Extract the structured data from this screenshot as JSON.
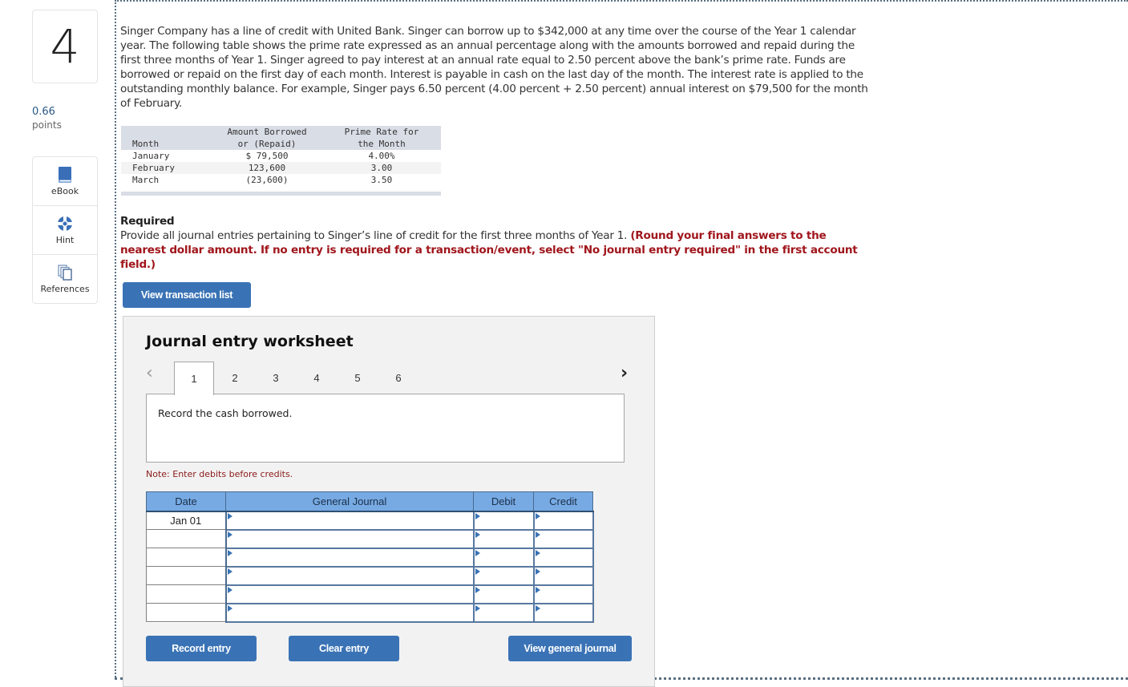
{
  "question": {
    "number": "4",
    "points_value": "0.66",
    "points_label": "points"
  },
  "tools": [
    {
      "label": "eBook",
      "icon": "book-icon"
    },
    {
      "label": "Hint",
      "icon": "lifebuoy-icon"
    },
    {
      "label": "References",
      "icon": "copy-pages-icon"
    }
  ],
  "intro_text": "Singer Company has a line of credit with United Bank. Singer can borrow up to $342,000 at any time over the course of the Year 1 calendar year. The following table shows the prime rate expressed as an annual percentage along with the amounts borrowed and repaid during the first three months of Year 1. Singer agreed to pay interest at an annual rate equal to 2.50 percent above the bank’s prime rate. Funds are borrowed or repaid on the first day of each month. Interest is payable in cash on the last day of the month. The interest rate is applied to the outstanding monthly balance. For example, Singer pays 6.50 percent (4.00 percent + 2.50 percent) annual interest on $79,500 for the month of February.",
  "rate_table": {
    "headers": {
      "month": "Month",
      "amount_line1": "Amount Borrowed",
      "amount_line2": "or (Repaid)",
      "rate_line1": "Prime Rate for",
      "rate_line2": "the Month"
    },
    "rows": [
      {
        "month": "January",
        "amount": "$ 79,500",
        "rate": "4.00%"
      },
      {
        "month": "February",
        "amount": "123,600",
        "rate": "3.00"
      },
      {
        "month": "March",
        "amount": "(23,600)",
        "rate": "3.50"
      }
    ]
  },
  "required": {
    "title": "Required",
    "text": "Provide all journal entries pertaining to Singer’s line of credit for the first three months of Year 1. ",
    "warning": "(Round your final answers to the nearest dollar amount. If no entry is required for a transaction/event, select \"No journal entry required\" in the first account field.)"
  },
  "buttons": {
    "view_transactions": "View transaction list",
    "record_entry": "Record entry",
    "clear_entry": "Clear entry",
    "view_general_journal": "View general journal"
  },
  "worksheet": {
    "title": "Journal entry worksheet",
    "tabs": [
      "1",
      "2",
      "3",
      "4",
      "5",
      "6"
    ],
    "active_tab": "1",
    "prev_glyph": "‹",
    "next_glyph": "›",
    "prompt": "Record the cash borrowed.",
    "note": "Note: Enter debits before credits.",
    "columns": {
      "date": "Date",
      "general_journal": "General Journal",
      "debit": "Debit",
      "credit": "Credit"
    },
    "rows": [
      {
        "date": "Jan 01",
        "account": "",
        "debit": "",
        "credit": ""
      },
      {
        "date": "",
        "account": "",
        "debit": "",
        "credit": ""
      },
      {
        "date": "",
        "account": "",
        "debit": "",
        "credit": ""
      },
      {
        "date": "",
        "account": "",
        "debit": "",
        "credit": ""
      },
      {
        "date": "",
        "account": "",
        "debit": "",
        "credit": ""
      },
      {
        "date": "",
        "account": "",
        "debit": "",
        "credit": ""
      }
    ]
  },
  "colors": {
    "primary_button": "#3a73b5",
    "table_header": "#77aae3",
    "warning_text": "#a0161c"
  }
}
